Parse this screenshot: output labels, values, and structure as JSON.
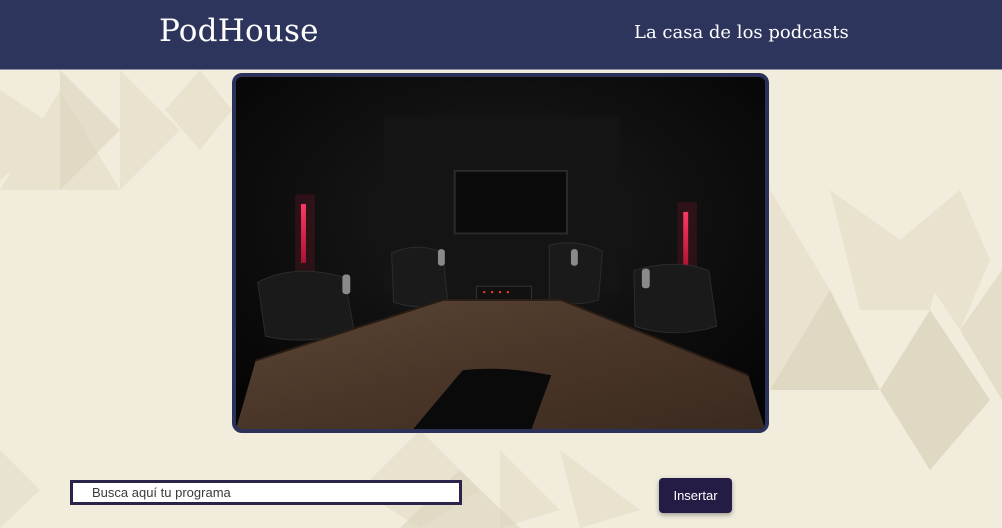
{
  "header": {
    "brand": "PodHouse",
    "tagline": "La casa de los podcasts"
  },
  "hero": {
    "image_subject": "podcast-studio-photo"
  },
  "search": {
    "placeholder": "Busca aquí tu programa",
    "value": ""
  },
  "actions": {
    "insert_label": "Insertar"
  },
  "colors": {
    "header_bg": "#2e355c",
    "page_bg": "#f1ecdc",
    "button_bg": "#241c44",
    "hero_border": "#2c3159"
  }
}
